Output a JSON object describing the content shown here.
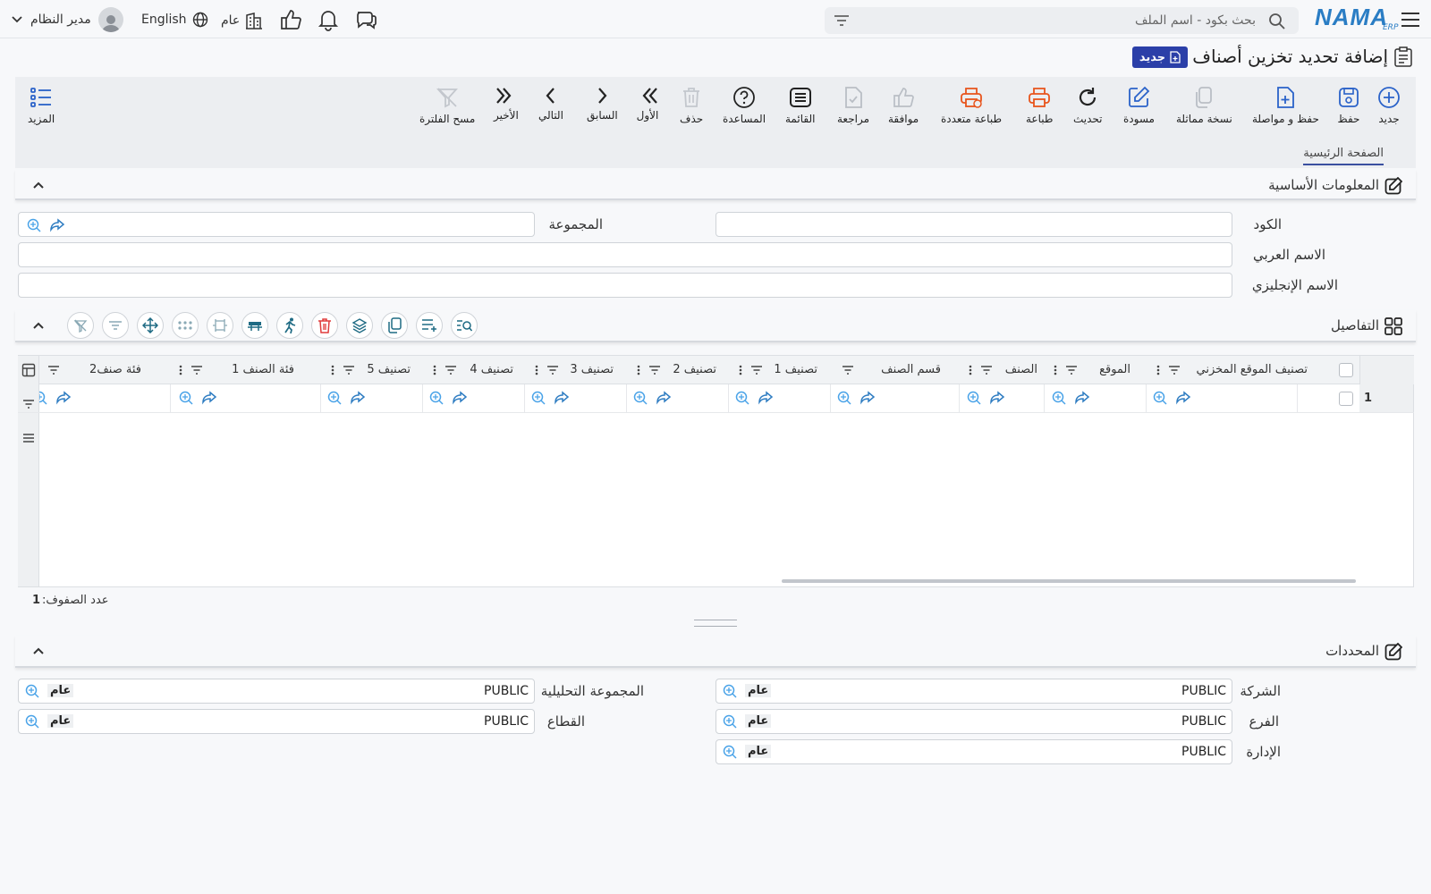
{
  "topbar": {
    "logo": "NAMA",
    "logo_sub": "ERP",
    "search_placeholder": "بحث بكود - اسم الملف",
    "user": "مدير النظام",
    "language": "English",
    "company": "عام"
  },
  "page": {
    "title": "إضافة تحديد تخزين أصناف",
    "badge": "جديد"
  },
  "toolbar": [
    {
      "key": "new",
      "label": "جديد",
      "icon": "plus-circle-icon"
    },
    {
      "key": "save",
      "label": "حفظ",
      "icon": "save-icon"
    },
    {
      "key": "save_continue",
      "label": "حفظ و مواصلة",
      "icon": "file-plus-icon"
    },
    {
      "key": "copy",
      "label": "نسخة مماثلة",
      "icon": "copy-icon"
    },
    {
      "key": "draft",
      "label": "مسودة",
      "icon": "edit-icon"
    },
    {
      "key": "refresh",
      "label": "تحديث",
      "icon": "refresh-icon"
    },
    {
      "key": "print",
      "label": "طباعة",
      "icon": "printer-icon"
    },
    {
      "key": "multi_print",
      "label": "طباعة متعددة",
      "icon": "multi-printer-icon"
    },
    {
      "key": "approve",
      "label": "موافقة",
      "icon": "thumbs-up-icon"
    },
    {
      "key": "review",
      "label": "مراجعة",
      "icon": "file-check-icon"
    },
    {
      "key": "list",
      "label": "القائمة",
      "icon": "list-icon"
    },
    {
      "key": "help",
      "label": "المساعدة",
      "icon": "help-icon"
    },
    {
      "key": "delete",
      "label": "حذف",
      "icon": "trash-icon"
    },
    {
      "key": "first",
      "label": "الأول",
      "icon": "double-chevron-right-icon"
    },
    {
      "key": "prev",
      "label": "السابق",
      "icon": "chevron-right-icon"
    },
    {
      "key": "next",
      "label": "التالي",
      "icon": "chevron-left-icon"
    },
    {
      "key": "last",
      "label": "الأخير",
      "icon": "double-chevron-left-icon"
    },
    {
      "key": "clear_filter",
      "label": "مسح الفلترة",
      "icon": "filter-off-icon"
    },
    {
      "key": "more",
      "label": "المزيد",
      "icon": "more-list-icon"
    }
  ],
  "tabs": {
    "home": "الصفحة الرئيسية"
  },
  "basic_info": {
    "title": "المعلومات الأساسية",
    "code_label": "الكود",
    "group_label": "المجموعة",
    "arabic_name_label": "الاسم العربي",
    "english_name_label": "الاسم الإنجليزي"
  },
  "details": {
    "title": "التفاصيل",
    "columns": [
      "تصنيف الموقع المخزني",
      "الموقع",
      "الصنف",
      "قسم الصنف",
      "تصنيف 1",
      "تصنيف 2",
      "تصنيف 3",
      "تصنيف 4",
      "تصنيف 5",
      "فئة الصنف 1",
      "فئة صنف2"
    ],
    "row_number": "1",
    "row_count_label": "عدد الصفوف:",
    "row_count": "1"
  },
  "determinants": {
    "title": "المحددات",
    "company_label": "الشركة",
    "branch_label": "الفرع",
    "department_label": "الإدارة",
    "analytic_group_label": "المجموعة التحليلية",
    "sector_label": "القطاع",
    "value": "PUBLIC",
    "value_name": "عام"
  }
}
